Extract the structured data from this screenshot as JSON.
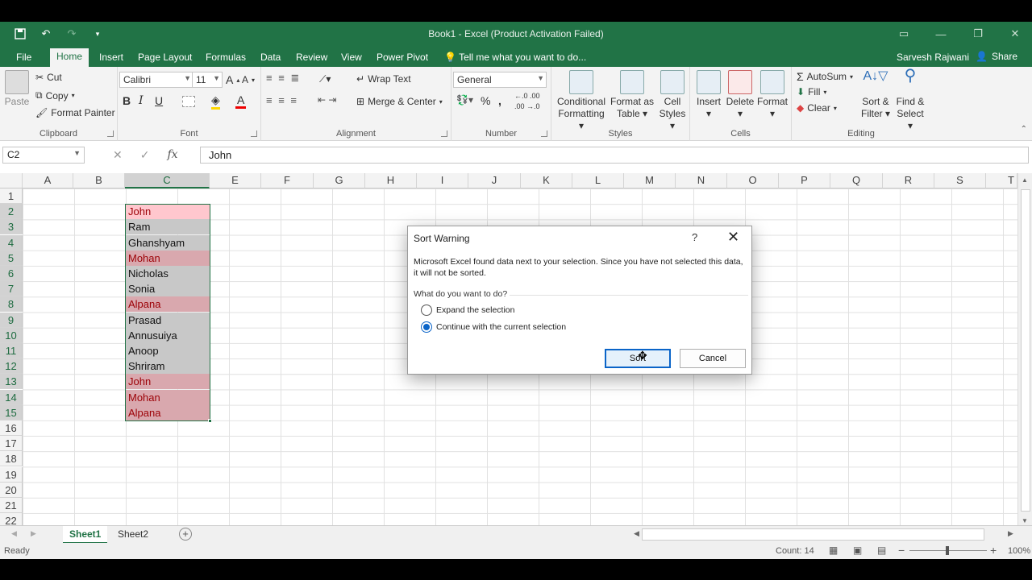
{
  "window": {
    "title": "Book1 - Excel (Product Activation Failed)"
  },
  "ribbon_tabs": [
    "File",
    "Home",
    "Insert",
    "Page Layout",
    "Formulas",
    "Data",
    "Review",
    "View",
    "Power Pivot"
  ],
  "tell_me": "Tell me what you want to do...",
  "user": "Sarvesh Rajwani",
  "share": "Share",
  "clipboard": {
    "label": "Clipboard",
    "paste": "Paste",
    "cut": "Cut",
    "copy": "Copy",
    "format_painter": "Format Painter"
  },
  "font": {
    "label": "Font",
    "name": "Calibri",
    "size": "11"
  },
  "alignment": {
    "label": "Alignment",
    "wrap_text": "Wrap Text",
    "merge_center": "Merge & Center"
  },
  "number": {
    "label": "Number",
    "format": "General"
  },
  "styles": {
    "label": "Styles",
    "conditional_1": "Conditional",
    "conditional_2": "Formatting",
    "format_as_1": "Format as",
    "format_as_2": "Table",
    "cell_1": "Cell",
    "cell_2": "Styles"
  },
  "cells_group": {
    "label": "Cells",
    "insert": "Insert",
    "delete": "Delete",
    "format": "Format"
  },
  "editing": {
    "label": "Editing",
    "autosum": "AutoSum",
    "fill": "Fill",
    "clear": "Clear",
    "sort_1": "Sort &",
    "sort_2": "Filter",
    "find_1": "Find &",
    "find_2": "Select"
  },
  "formula_bar": {
    "name_box": "C2",
    "content": "John"
  },
  "columns": [
    "A",
    "B",
    "C",
    "E",
    "F",
    "G",
    "H",
    "I",
    "J",
    "K",
    "L",
    "M",
    "N",
    "O",
    "P",
    "Q",
    "R",
    "S",
    "T"
  ],
  "rows": [
    "1",
    "2",
    "3",
    "4",
    "5",
    "6",
    "7",
    "8",
    "9",
    "10",
    "11",
    "12",
    "13",
    "14",
    "15",
    "16",
    "17",
    "18",
    "19",
    "20",
    "21",
    "22"
  ],
  "column_c": [
    {
      "text": "John",
      "dup": true
    },
    {
      "text": "Ram",
      "dup": false
    },
    {
      "text": "Ghanshyam",
      "dup": false
    },
    {
      "text": "Mohan",
      "dup": true
    },
    {
      "text": "Nicholas",
      "dup": false
    },
    {
      "text": "Sonia",
      "dup": false
    },
    {
      "text": "Alpana",
      "dup": true
    },
    {
      "text": "Prasad",
      "dup": false
    },
    {
      "text": "Annusuiya",
      "dup": false
    },
    {
      "text": "Anoop",
      "dup": false
    },
    {
      "text": "Shriram",
      "dup": false
    },
    {
      "text": "John",
      "dup": true
    },
    {
      "text": "Mohan",
      "dup": true
    },
    {
      "text": "Alpana",
      "dup": true
    }
  ],
  "colors": {
    "excel_green": "#217346",
    "dup_fill": "#ffc7ce",
    "dup_text": "#9c0006",
    "selection_tint": "#c8c8c8"
  },
  "sheets": [
    "Sheet1",
    "Sheet2"
  ],
  "status": {
    "ready": "Ready",
    "count": "Count: 14",
    "zoom": "100%"
  },
  "dialog": {
    "title": "Sort Warning",
    "help": "?",
    "message": "Microsoft Excel found data next to your selection.  Since you have not selected this data, it will not be sorted.",
    "question": "What do you want to do?",
    "option_expand": "Expand the selection",
    "option_continue": "Continue with the current selection",
    "sort_button": "Sort",
    "cancel_button": "Cancel"
  }
}
